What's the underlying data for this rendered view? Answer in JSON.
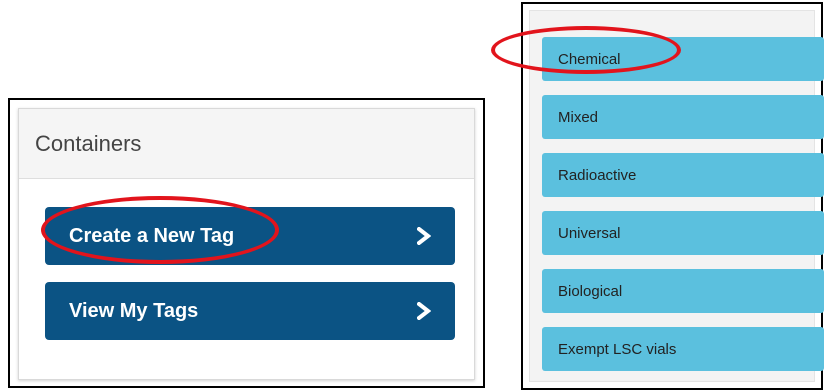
{
  "containers": {
    "title": "Containers",
    "buttons": [
      {
        "label": "Create a New Tag",
        "icon": "chevron-right-icon"
      },
      {
        "label": "View My Tags",
        "icon": "chevron-right-icon"
      }
    ]
  },
  "tags": {
    "items": [
      {
        "label": "Chemical"
      },
      {
        "label": "Mixed"
      },
      {
        "label": "Radioactive"
      },
      {
        "label": "Universal"
      },
      {
        "label": "Biological"
      },
      {
        "label": "Exempt LSC vials"
      }
    ]
  },
  "colors": {
    "dark_button": "#0b5384",
    "tag_button": "#5bc0de",
    "annotation": "#e2141c"
  }
}
